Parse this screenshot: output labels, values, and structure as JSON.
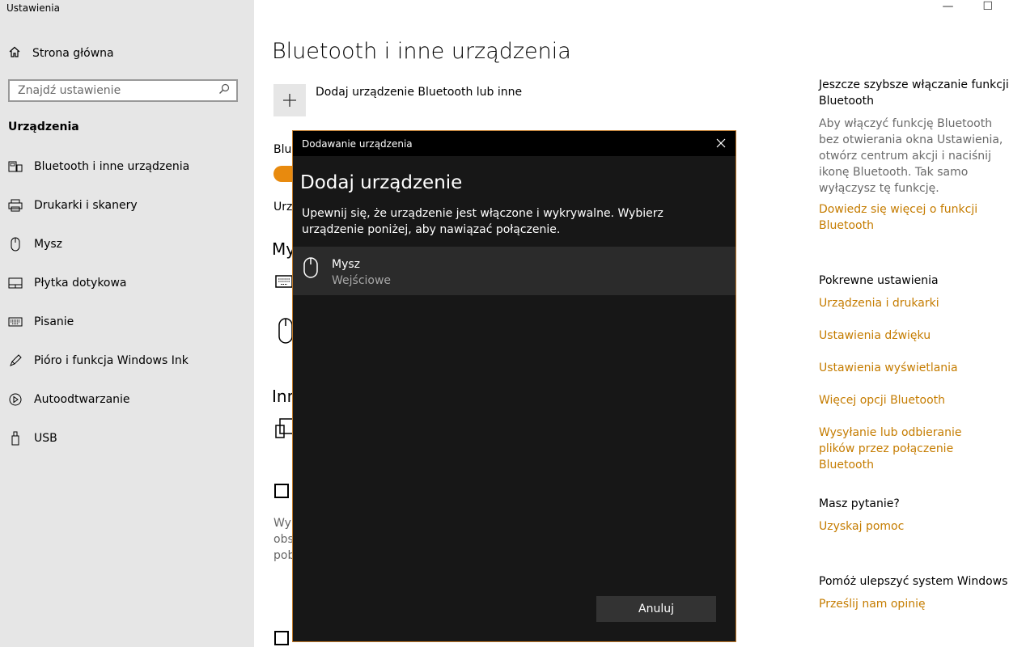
{
  "app": {
    "title": "Ustawienia"
  },
  "window": {
    "minimize": "—",
    "maximize": "☐"
  },
  "sidebar": {
    "home_label": "Strona główna",
    "search_placeholder": "Znajdź ustawienie",
    "section": "Urządzenia",
    "items": [
      {
        "label": "Bluetooth i inne urządzenia",
        "icon": "bluetooth-devices-icon"
      },
      {
        "label": "Drukarki i skanery",
        "icon": "printer-icon"
      },
      {
        "label": "Mysz",
        "icon": "mouse-icon"
      },
      {
        "label": "Płytka dotykowa",
        "icon": "touchpad-icon"
      },
      {
        "label": "Pisanie",
        "icon": "keyboard-icon"
      },
      {
        "label": "Pióro i funkcja Windows Ink",
        "icon": "pen-icon"
      },
      {
        "label": "Autoodtwarzanie",
        "icon": "autoplay-icon"
      },
      {
        "label": "USB",
        "icon": "usb-icon"
      }
    ]
  },
  "main": {
    "title": "Bluetooth i inne urządzenia",
    "add_device": "Dodaj urządzenie Bluetooth lub inne",
    "fragments": {
      "bluetooth": "Blue",
      "status": "Urz",
      "my_devices": "My",
      "other": "Inn",
      "desc1": "Wy",
      "desc2": "obs",
      "desc3": "pob"
    }
  },
  "right_panel": {
    "tip_heading": "Jeszcze szybsze włączanie funkcji Bluetooth",
    "tip_text": "Aby włączyć funkcję Bluetooth bez otwierania okna Ustawienia, otwórz centrum akcji i naciśnij ikonę Bluetooth. Tak samo wyłączysz tę funkcję.",
    "tip_link": "Dowiedz się więcej o funkcji Bluetooth",
    "related_heading": "Pokrewne ustawienia",
    "related_links": [
      "Urządzenia i drukarki",
      "Ustawienia dźwięku",
      "Ustawienia wyświetlania",
      "Więcej opcji Bluetooth",
      "Wysyłanie lub odbieranie plików przez połączenie Bluetooth"
    ],
    "question_heading": "Masz pytanie?",
    "question_link": "Uzyskaj pomoc",
    "feedback_heading": "Pomóż ulepszyć system Windows",
    "feedback_link": "Prześlij nam opinię"
  },
  "dialog": {
    "title": "Dodawanie urządzenia",
    "heading": "Dodaj urządzenie",
    "description": "Upewnij się, że urządzenie jest włączone i wykrywalne. Wybierz urządzenie poniżej, aby nawiązać połączenie.",
    "devices": [
      {
        "name": "Mysz",
        "type": "Wejściowe",
        "icon": "mouse-icon"
      }
    ],
    "cancel": "Anuluj"
  },
  "colors": {
    "accent": "#c57c00",
    "toggle": "#e88a0e",
    "dialog_bg": "#171717"
  }
}
